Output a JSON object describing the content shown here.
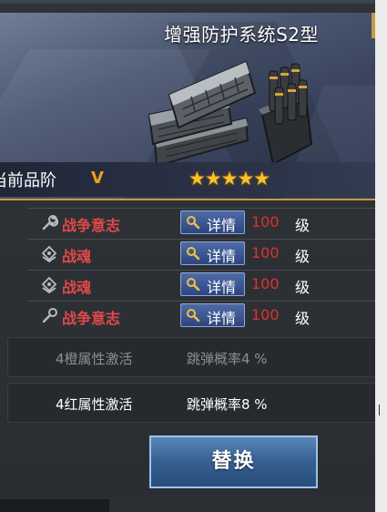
{
  "header": {
    "title": "增强防护系统S2型",
    "grade_label": "当前品阶",
    "grade_value": "V",
    "stars": "★★★★★",
    "star_count": 5
  },
  "attributes": [
    {
      "name": "战争意志",
      "icon": "wrench-icon",
      "detail_label": "详情",
      "value": "100",
      "unit": "级"
    },
    {
      "name": "战魂",
      "icon": "soul-emblem-icon",
      "detail_label": "详情",
      "value": "100",
      "unit": "级"
    },
    {
      "name": "战魂",
      "icon": "soul-emblem-icon",
      "detail_label": "详情",
      "value": "100",
      "unit": "级"
    },
    {
      "name": "战争意志",
      "icon": "wrench-icon",
      "detail_label": "详情",
      "value": "100",
      "unit": "级"
    }
  ],
  "bonuses": [
    {
      "label": "4橙属性激活",
      "value": "跳弹概率4 %",
      "active": false
    },
    {
      "label": "4红属性激活",
      "value": "跳弹概率8 %",
      "active": true
    }
  ],
  "actions": {
    "replace_label": "替换"
  },
  "colors": {
    "accent_gold": "#c79a45",
    "attr_red": "#e14848",
    "star_gold": "#f5c12c",
    "grade_orange": "#f0a020",
    "button_blue": "#355f90"
  }
}
